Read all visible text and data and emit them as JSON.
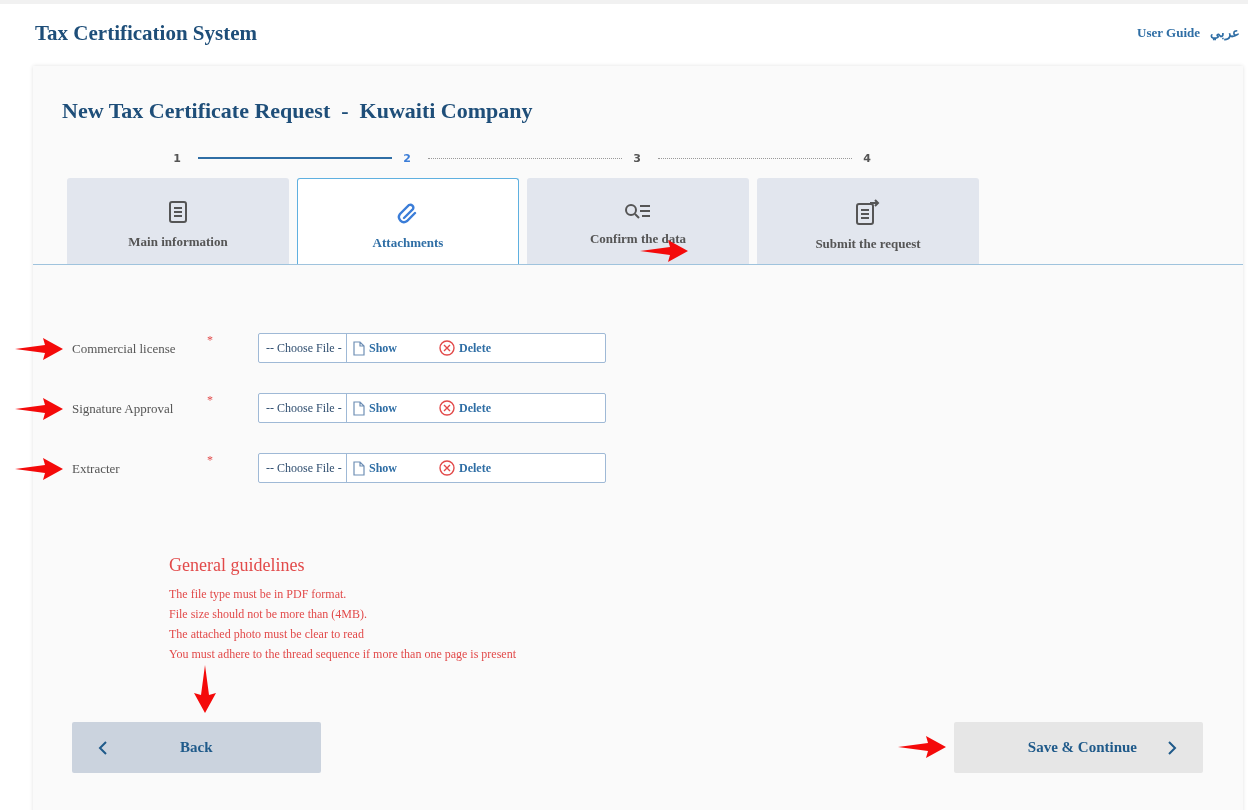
{
  "header": {
    "title": "Tax Certification System",
    "links": [
      "User Guide",
      "عربي"
    ]
  },
  "page_title": "New Tax Certificate Request  -  Kuwaiti Company",
  "steps": [
    {
      "number": "1",
      "selected": false
    },
    {
      "number": "2",
      "selected": true
    },
    {
      "number": "3",
      "selected": false
    },
    {
      "number": "4",
      "selected": false
    }
  ],
  "tabs": [
    {
      "label": "Main information",
      "selected": false,
      "marked": false
    },
    {
      "label": "Attachments",
      "selected": true,
      "marked": false
    },
    {
      "label": "Confirm the data",
      "selected": false,
      "marked": true
    },
    {
      "label": "Submit the request",
      "selected": false,
      "marked": false
    }
  ],
  "attachments": [
    {
      "label": "Commercial license",
      "required": "*",
      "placeholder": "-- Choose File -",
      "show": "Show",
      "delete": "Delete",
      "marked": true
    },
    {
      "label": "Signature Approval",
      "required": "*",
      "placeholder": "-- Choose File -",
      "show": "Show",
      "delete": "Delete",
      "marked": true
    },
    {
      "label": "Extracter",
      "required": "*",
      "placeholder": "-- Choose File -",
      "show": "Show",
      "delete": "Delete",
      "marked": true
    }
  ],
  "guidelines": {
    "title": "General guidelines",
    "items": [
      "The file type must be in PDF format.",
      "File size should not be more than (4MB).",
      "The attached photo must be clear to read",
      "You must adhere to the thread sequence if more than one page is present"
    ]
  },
  "buttons": [
    {
      "label": "Back",
      "kind": "back",
      "marked": true
    },
    {
      "label": "Save & Continue",
      "kind": "next",
      "marked": true
    }
  ]
}
